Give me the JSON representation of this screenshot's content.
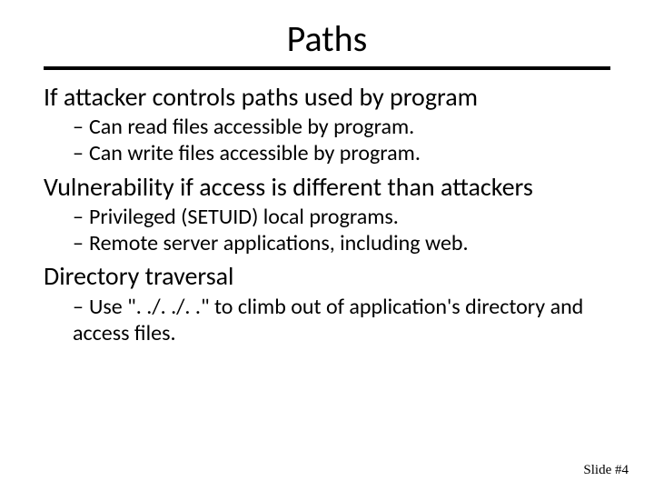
{
  "title": "Paths",
  "sections": [
    {
      "heading": "If attacker controls paths used by program",
      "items": [
        "Can read files accessible by program.",
        "Can write files accessible by program."
      ]
    },
    {
      "heading": "Vulnerability if access is different than attackers",
      "items": [
        "Privileged (SETUID) local programs.",
        "Remote server applications, including web."
      ]
    },
    {
      "heading": "Directory traversal",
      "items": [
        "Use \". ./. ./. .\" to climb out of application's directory and access files."
      ]
    }
  ],
  "footer": "Slide #4",
  "dash": "–"
}
